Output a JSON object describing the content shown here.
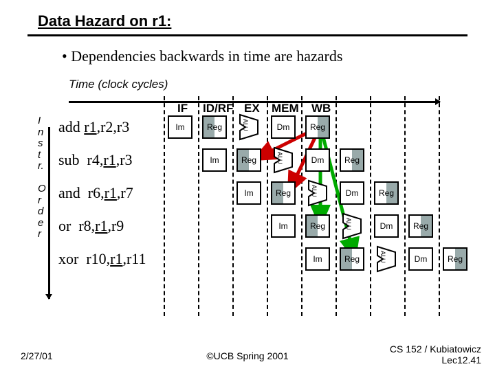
{
  "title": "Data Hazard on r1:",
  "bullet": "• Dependencies backwards in time are hazards",
  "time_label": "Time (clock cycles)",
  "order_label": [
    "I",
    "n",
    "s",
    "t",
    "r.",
    "",
    "O",
    "r",
    "d",
    "e",
    "r"
  ],
  "stages": [
    "IF",
    "ID/RF",
    "EX",
    "MEM",
    "WB"
  ],
  "pipe_labels": {
    "im": "Im",
    "reg": "Reg",
    "dm": "Dm",
    "alu": "ALU"
  },
  "instructions": [
    {
      "op": "add",
      "dst": "r1",
      "srcs": "r2,r3"
    },
    {
      "op": "sub",
      "dst": "r4",
      "srcs": "r1,r3",
      "u": 1
    },
    {
      "op": "and",
      "dst": "r6",
      "srcs": "r1,r7",
      "u": 1
    },
    {
      "op": "or",
      "dst": "r8",
      "srcs": "r1,r9",
      "u": 1
    },
    {
      "op": "xor",
      "dst": "r10",
      "srcs": "r1,r11",
      "u": 1
    }
  ],
  "footer": {
    "date": "2/27/01",
    "center": "©UCB Spring 2001",
    "right1": "CS 152 / Kubiatowicz",
    "right2": "Lec12.41"
  }
}
